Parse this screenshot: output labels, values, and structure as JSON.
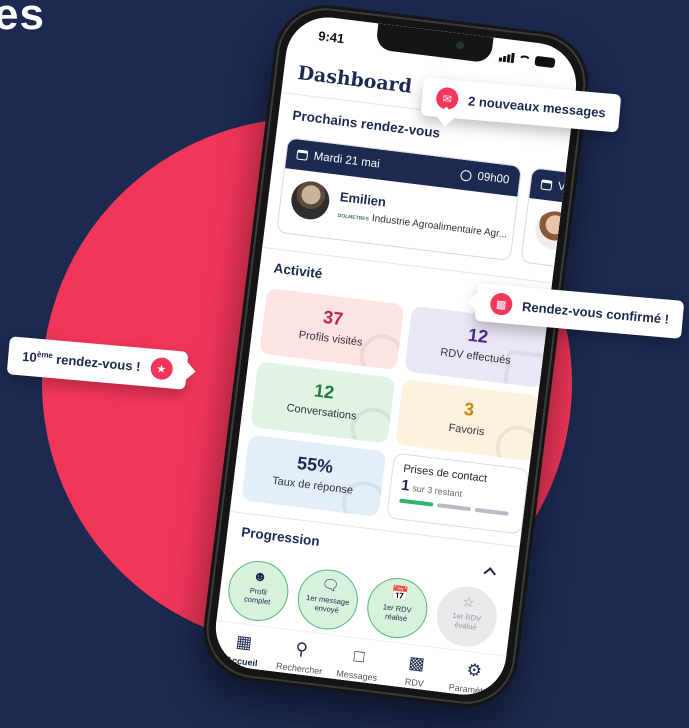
{
  "headline": "es",
  "status": {
    "time": "9:41"
  },
  "app": {
    "title": "Dashboard"
  },
  "upcoming": {
    "title": "Prochains rendez-vous",
    "cards": [
      {
        "date": "Mardi 21 mai",
        "time": "09h00",
        "name": "Emilien",
        "company": "Industrie Agroalimentaire Agr...",
        "logo_text": "DOLMETRES"
      },
      {
        "date": "Ve"
      }
    ]
  },
  "activity": {
    "title": "Activité",
    "tiles": [
      {
        "value": "37",
        "label": "Profils visités",
        "bg": "#fde3e4",
        "color": "#c42646"
      },
      {
        "value": "12",
        "label": "RDV effectués",
        "bg": "#ebe6f5",
        "color": "#4a2a86"
      },
      {
        "value": "12",
        "label": "Conversations",
        "bg": "#e0f3e4",
        "color": "#1f7c43"
      },
      {
        "value": "3",
        "label": "Favoris",
        "bg": "#fdf2df",
        "color": "#c9880c"
      },
      {
        "value": "55%",
        "label": "Taux de réponse",
        "bg": "#e4eefb",
        "color": "#1c2950"
      }
    ],
    "contact": {
      "title": "Prises de contact",
      "value": "1",
      "suffix": "sur 3 restant",
      "progress": 0.3333
    }
  },
  "progression": {
    "title": "Progression",
    "steps": [
      {
        "line1": "Profil",
        "line2": "complet",
        "icon": "user-icon",
        "done": true
      },
      {
        "line1": "1er message",
        "line2": "envoyé",
        "icon": "chat-icon",
        "done": true
      },
      {
        "line1": "1er RDV",
        "line2": "réalisé",
        "icon": "calendar-icon",
        "done": true
      },
      {
        "line1": "1er RDV",
        "line2": "évalué",
        "icon": "star-icon",
        "done": false
      }
    ]
  },
  "tabbar": [
    {
      "label": "Accueil",
      "icon": "grid-icon",
      "active": true
    },
    {
      "label": "Rechercher",
      "icon": "search-icon"
    },
    {
      "label": "Messages",
      "icon": "message-icon"
    },
    {
      "label": "RDV",
      "icon": "calendar-icon"
    },
    {
      "label": "Paramètres",
      "icon": "gear-icon"
    }
  ],
  "toasts": {
    "messages": "2 nouveaux messages",
    "confirmed": "Rendez-vous confirmé !",
    "milestone_prefix": "10",
    "milestone_sup": "ème",
    "milestone_suffix": " rendez-vous !"
  },
  "colors": {
    "navy": "#1c2950",
    "accent": "#f1365a",
    "green": "#2fb36b"
  }
}
